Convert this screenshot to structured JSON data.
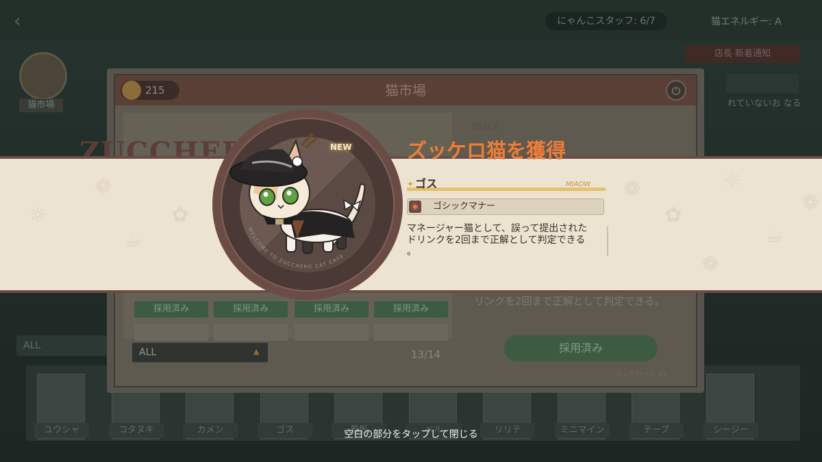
{
  "background": {
    "staff_count": "にゃんこスタッフ: 6/7",
    "energy_label": "猫エネルギー: A",
    "shop_label": "猫市場",
    "right_tag": "店長 新着通知",
    "right_note": "れていないお なる",
    "filter_value": "ALL",
    "cat_cards": [
      "ユウシャ",
      "コタヌキ",
      "カメン",
      "ゴス",
      "看板",
      "ベル",
      "リリテ",
      "ミニマイン",
      "テーブ",
      "シージー"
    ]
  },
  "market": {
    "title": "猫市場",
    "coins": "215",
    "adopt_label": "採用済み",
    "filter_value": "ALL",
    "page": "13/14",
    "detail_text": "リンクを2回まで正解として判定できる。",
    "detail_button": "採用済み",
    "footer_text": "ズッケロヘル V1",
    "brand_text": "ZUCCHERO CAFÉ",
    "tails_logo": "TAILS"
  },
  "reward": {
    "badge": "NEW",
    "title": "ズッケロ猫を獲得",
    "cat_name": "ゴス",
    "meow": "MIAOW",
    "skill_name": "ゴシックマナー",
    "skill_desc_line1": "マネージャー猫として、誤って提出された",
    "skill_desc_line2": "ドリンクを2回まで正解として判定できる",
    "skill_desc_line3": "。",
    "medal_caption": "WELCOME TO ZUCCHERO CAT CAFE"
  },
  "close_hint": "空白の部分をタップして閉じる",
  "colors": {
    "accent": "#ef7d38",
    "band": "#ede3d1",
    "band_border": "#6b4c45",
    "name_bar": "#e3c06a"
  }
}
